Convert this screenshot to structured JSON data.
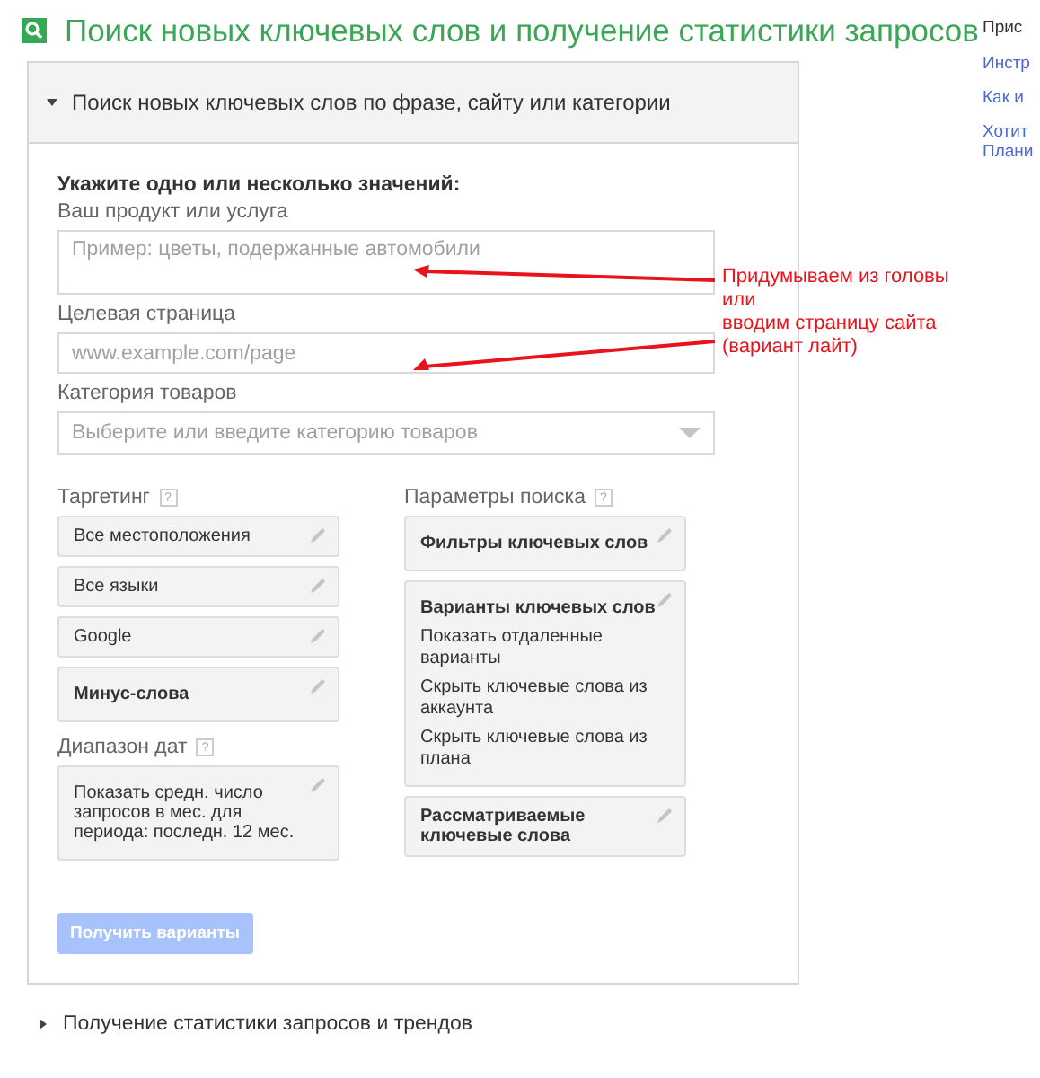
{
  "page_title": "Поиск новых ключевых слов и получение статистики запросов",
  "panel": {
    "title": "Поиск новых ключевых слов по фразе, сайту или категории",
    "expanded": true,
    "intro": "Укажите одно или несколько значений:",
    "fields": [
      {
        "kind": "textarea",
        "label": "Ваш продукт или услуга",
        "placeholder": "Пример: цветы, подержанные автомобили"
      },
      {
        "kind": "input",
        "label": "Целевая страница",
        "placeholder": "www.example.com/page"
      },
      {
        "kind": "select",
        "label": "Категория товаров",
        "placeholder": "Выберите или введите категорию товаров"
      }
    ],
    "left_groups": [
      {
        "title": "Таргетинг",
        "help": "?",
        "items": [
          {
            "title": "Все местоположения",
            "bold": false
          },
          {
            "title": "Все языки",
            "bold": false
          },
          {
            "title": "Google",
            "bold": false
          },
          {
            "title": "Минус-слова",
            "bold": true
          }
        ]
      },
      {
        "title": "Диапазон дат",
        "help": "?",
        "items": [
          {
            "title": "Показать средн. число запросов в мес. для периода: последн. 12 мес.",
            "bold": false
          }
        ]
      }
    ],
    "right_groups": [
      {
        "title": "Параметры поиска",
        "help": "?",
        "items": [
          {
            "title": "Фильтры ключевых слов",
            "bold": true
          },
          {
            "title": "Варианты ключевых слов",
            "bold": true,
            "lines": [
              "Показать отдаленные варианты",
              "Скрыть ключевые слова из аккаунта",
              "Скрыть ключевые слова из плана"
            ]
          },
          {
            "title": "Рассматриваемые ключевые слова",
            "bold": true
          }
        ]
      }
    ],
    "submit": {
      "label": "Получить варианты",
      "disabled": true
    }
  },
  "second_section": {
    "title": "Получение статистики запросов и трендов",
    "expanded": false
  },
  "sidebar": {
    "heading": "Прис",
    "links": [
      "Инстр",
      "Как и",
      "Хотит\nПлани"
    ]
  },
  "annotation": {
    "lines": [
      "Придумываем из головы",
      "или",
      "вводим страницу сайта (вариант лайт)"
    ]
  }
}
